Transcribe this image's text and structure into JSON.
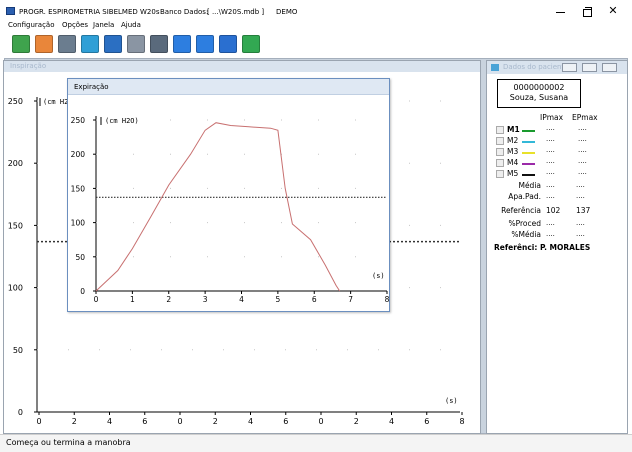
{
  "titlebar": {
    "app_title": "PROGR. ESPIROMETRIA SIBELMED W20s",
    "db_label": "Banco Dados:",
    "db_path": "[ ...\\W20S.mdb ]",
    "mode": "DEMO",
    "close_glyph": "✕"
  },
  "menu": [
    "Configuração",
    "Opções",
    "Janela",
    "Ajuda"
  ],
  "toolbar": {
    "buttons": [
      {
        "name": "record-icon",
        "color": "#3fa34d"
      },
      {
        "name": "chart-icon",
        "color": "#e9863a"
      },
      {
        "name": "patients-icon",
        "color": "#6b7d8f"
      },
      {
        "name": "refresh-icon",
        "color": "#2f9fd6"
      },
      {
        "name": "save-icon",
        "color": "#2b6fc2"
      },
      {
        "name": "report-icon",
        "color": "#8a95a3"
      },
      {
        "name": "print-icon",
        "color": "#5a6a7c"
      },
      {
        "name": "zoom-in-icon",
        "color": "#2d7ee0"
      },
      {
        "name": "zoom-out-icon",
        "color": "#2d7ee0"
      },
      {
        "name": "info-icon",
        "color": "#2a6fd0"
      },
      {
        "name": "back-arrow-icon",
        "color": "#32a852"
      }
    ]
  },
  "main_window": {
    "title": "Inspiração"
  },
  "exp_window": {
    "title": "Expiração"
  },
  "info_panel": {
    "title": "Dados do paciente",
    "patient_id": "0000000002",
    "patient_name": "Souza, Susana",
    "col_ip": "IPmax",
    "col_ep": "EPmax",
    "maneuvers": [
      {
        "label": "M1",
        "color": "#1a9a2e",
        "ip": "....",
        "ep": "....",
        "bold": true
      },
      {
        "label": "M2",
        "color": "#33b8d8",
        "ip": "....",
        "ep": "...."
      },
      {
        "label": "M3",
        "color": "#e8e12a",
        "ip": "....",
        "ep": "...."
      },
      {
        "label": "M4",
        "color": "#9b2aa8",
        "ip": "....",
        "ep": "...."
      },
      {
        "label": "M5",
        "color": "#111111",
        "ip": "....",
        "ep": "...."
      }
    ],
    "rows": [
      {
        "label": "Média",
        "ip": "....",
        "ep": "...."
      },
      {
        "label": "Apa.Pad.",
        "ip": "....",
        "ep": "...."
      },
      {
        "label": "Referência",
        "ip": "102",
        "ep": "137"
      },
      {
        "label": "%Proced",
        "ip": "....",
        "ep": "...."
      },
      {
        "label": "%Média",
        "ip": "....",
        "ep": "...."
      }
    ],
    "reference_line": "Referênci: P. MORALES"
  },
  "status": {
    "text": "Começa ou termina a manobra"
  },
  "chart_data": [
    {
      "id": "inspiracao",
      "type": "line",
      "ylabel": "(cm H2O)",
      "xlabel": "(s)",
      "ylim": [
        0,
        250
      ],
      "yticks": [
        0,
        50,
        100,
        150,
        200,
        250
      ],
      "xtick_labels": [
        "0",
        "2",
        "4",
        "6",
        "0",
        "2",
        "4",
        "6",
        "0",
        "2",
        "4",
        "6",
        "8"
      ],
      "grid": "dotted",
      "series": [
        {
          "values": [],
          "color": "#c87070"
        }
      ],
      "reference_value": 137
    },
    {
      "id": "expiracao",
      "type": "line",
      "ylabel": "(cm H2O)",
      "xlabel": "(s)",
      "xlim": [
        0,
        8
      ],
      "ylim": [
        0,
        250
      ],
      "xticks": [
        0,
        1,
        2,
        3,
        4,
        5,
        6,
        7,
        8
      ],
      "yticks": [
        0,
        50,
        100,
        150,
        200,
        250
      ],
      "grid": "dotted",
      "series": [
        {
          "color": "#c87070",
          "x": [
            0,
            0.6,
            1.0,
            1.5,
            2.0,
            2.6,
            3.0,
            3.3,
            3.7,
            4.2,
            4.8,
            5.0,
            5.2,
            5.4,
            5.9,
            6.3,
            6.6,
            6.7
          ],
          "y": [
            0,
            30,
            62,
            108,
            155,
            200,
            235,
            246,
            242,
            240,
            238,
            235,
            150,
            98,
            75,
            38,
            8,
            0
          ]
        }
      ],
      "reference_value": 137
    }
  ]
}
